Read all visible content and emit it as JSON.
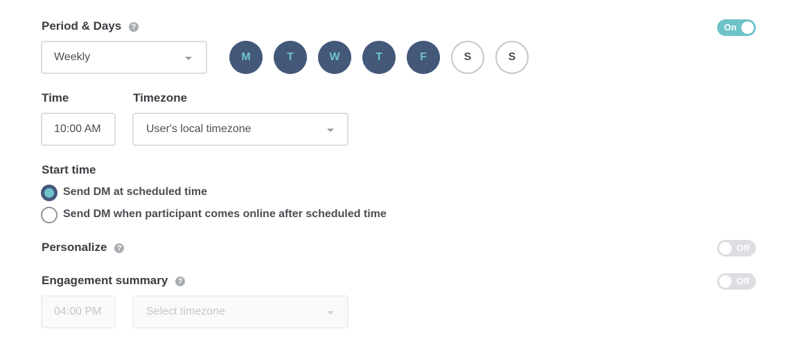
{
  "period": {
    "label": "Period & Days",
    "help": "?",
    "select_value": "Weekly",
    "toggle_label": "On",
    "days": [
      {
        "letter": "M",
        "selected": true
      },
      {
        "letter": "T",
        "selected": true
      },
      {
        "letter": "W",
        "selected": true
      },
      {
        "letter": "T",
        "selected": true
      },
      {
        "letter": "F",
        "selected": true
      },
      {
        "letter": "S",
        "selected": false
      },
      {
        "letter": "S",
        "selected": false
      }
    ]
  },
  "time": {
    "label": "Time",
    "value": "10:00 AM"
  },
  "timezone": {
    "label": "Timezone",
    "value": "User's local timezone"
  },
  "start_time": {
    "label": "Start time",
    "options": [
      {
        "label": "Send DM at scheduled time",
        "checked": true
      },
      {
        "label": "Send DM when participant comes online after scheduled time",
        "checked": false
      }
    ]
  },
  "personalize": {
    "label": "Personalize",
    "help": "?",
    "toggle_label": "Off"
  },
  "engagement": {
    "label": "Engagement summary",
    "help": "?",
    "toggle_label": "Off",
    "time_placeholder": "04:00 PM",
    "timezone_placeholder": "Select timezone"
  },
  "colors": {
    "accent": "#6ec3c9",
    "navy": "#44587a",
    "toggle_off": "#dcdee1"
  }
}
